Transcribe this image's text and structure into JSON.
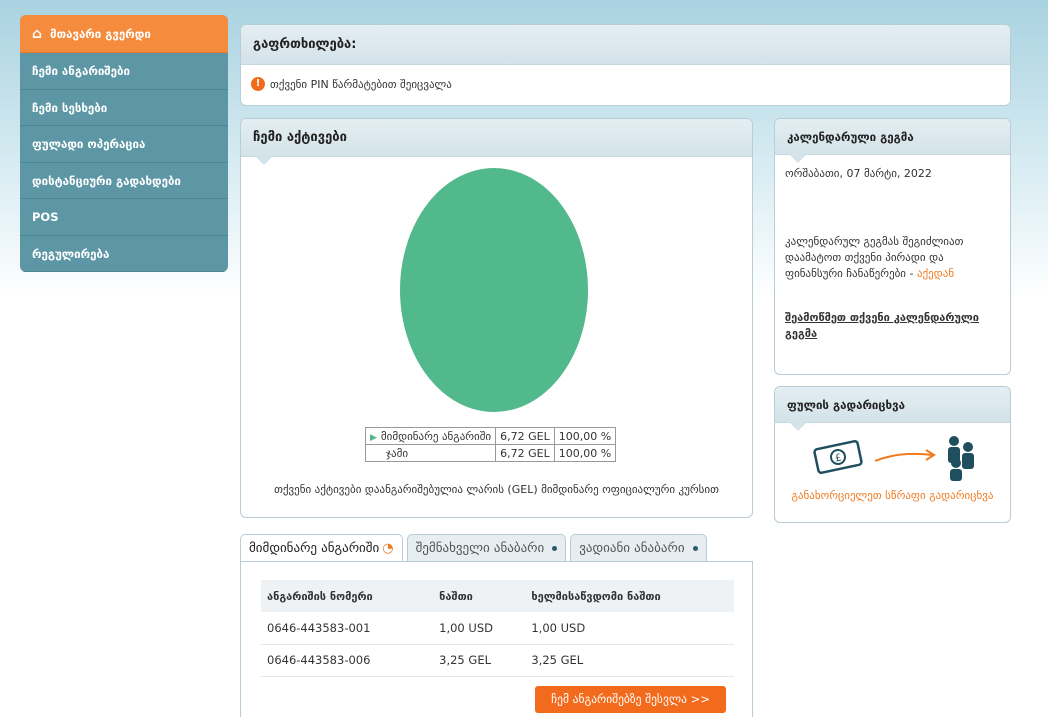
{
  "sidebar": {
    "items": [
      {
        "label": "მთავარი გვერდი"
      },
      {
        "label": "ჩემი ანგარიშები"
      },
      {
        "label": "ჩემი სესხები"
      },
      {
        "label": "ფულადი ოპერაცია"
      },
      {
        "label": "დისტანციური გადახდები"
      },
      {
        "label": "POS"
      },
      {
        "label": "რეგულირება"
      }
    ]
  },
  "warning": {
    "title": "გაფრთხილება:",
    "message": "თქვენი PIN წარმატებით შეიცვალა"
  },
  "assets": {
    "title": "ჩემი აქტივები",
    "legend": [
      {
        "name": "მიმდინარე ანგარიში",
        "amount": "6,72 GEL",
        "percent": "100,00 %"
      },
      {
        "name": "ჯამი",
        "amount": "6,72 GEL",
        "percent": "100,00 %"
      }
    ],
    "note": "თქვენი აქტივები დაანგარიშებულია ლარის (GEL) მიმდინარე ოფიციალური კურსით",
    "pie_color": "#52b98d"
  },
  "calendar": {
    "title": "კალენდარული გეგმა",
    "date": "ორშაბათი, 07 მარტი, 2022",
    "text": "კალენდარულ გეგმას შეგიძლიათ დაამატოთ თქვენი პირადი და ფინანსური ჩანაწერები - ",
    "text_link": "აქედან",
    "link": "შეამოწმეთ თქვენი კალენდარული გეგმა"
  },
  "transfer": {
    "title": "ფულის გადარიცხვა",
    "link": "განახორციელეთ სწრაფი გადარიცხვა"
  },
  "tabs": [
    {
      "label": "მიმდინარე ანგარიში"
    },
    {
      "label": "შემნახველი ანაბარი"
    },
    {
      "label": "ვადიანი ანაბარი"
    }
  ],
  "accounts": {
    "headers": [
      "ანგარიშის ნომერი",
      "ნაშთი",
      "ხელმისაწვდომი ნაშთი"
    ],
    "rows": [
      [
        "0646-443583-001",
        "1,00 USD",
        "1,00 USD"
      ],
      [
        "0646-443583-006",
        "3,25 GEL",
        "3,25 GEL"
      ]
    ],
    "button": "ჩემ ანგარიშებზე შესვლა >>"
  }
}
